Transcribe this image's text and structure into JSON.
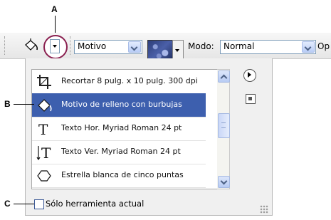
{
  "callouts": {
    "a": "A",
    "b": "B",
    "c": "C"
  },
  "options_bar": {
    "pattern_label": "Motivo",
    "mode_label": "Modo:",
    "mode_value": "Normal",
    "opacity_label_partial": "Op"
  },
  "presets": {
    "items": [
      {
        "label": "Recortar 8 pulg. x 10 pulg. 300 dpi",
        "icon": "crop-icon",
        "selected": false
      },
      {
        "label": "Motivo de relleno con burbujas",
        "icon": "paint-bucket-icon",
        "selected": true
      },
      {
        "label": "Texto Hor. Myriad Roman 24 pt",
        "icon": "horizontal-type-icon",
        "selected": false
      },
      {
        "label": "Texto Ver. Myriad Roman 24 pt",
        "icon": "vertical-type-icon",
        "selected": false
      },
      {
        "label": "Estrella blanca de cinco puntas",
        "icon": "polygon-icon",
        "selected": false
      }
    ]
  },
  "current_tool_only": {
    "label": "Sólo herramienta actual",
    "checked": false
  },
  "colors": {
    "selection": "#3d5fae",
    "callout_ring": "#8a2050"
  }
}
